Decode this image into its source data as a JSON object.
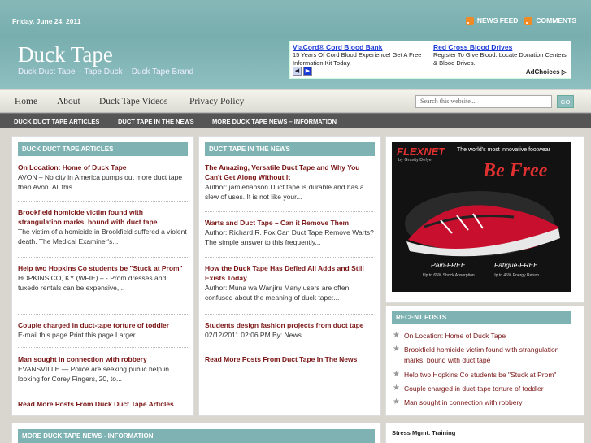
{
  "topbar": {
    "date": "Friday, June 24, 2011",
    "news_feed": "NEWS FEED",
    "comments": "COMMENTS"
  },
  "site": {
    "title": "Duck Tape",
    "tagline": "Duck Duct Tape – Tape Duck – Duck Tape Brand"
  },
  "ads": [
    {
      "title": "ViaCord® Cord Blood Bank",
      "text": "15 Years Of Cord Blood Experience! Get A Free Information Kit Today."
    },
    {
      "title": "Red Cross Blood Drives",
      "text": "Register To Give Blood. Locate Donation Centers & Blood Drives."
    }
  ],
  "adchoices": "AdChoices ▷",
  "nav": {
    "items": [
      "Home",
      "About",
      "Duck Tape Videos",
      "Privacy Policy"
    ],
    "search_placeholder": "Search this website...",
    "go": "GO"
  },
  "subnav": [
    "DUCK DUCT TAPE ARTICLES",
    "DUCT TAPE IN THE NEWS",
    "MORE DUCK TAPE NEWS – INFORMATION"
  ],
  "col1": {
    "heading": "DUCK DUCT TAPE ARTICLES",
    "posts": [
      {
        "title": "On Location: Home of Duck Tape",
        "text": "AVON – No city in America pumps out more duct tape than Avon. All this..."
      },
      {
        "title": "Brookfield homicide victim found with strangulation marks, bound with duct tape",
        "text": "The victim of a homicide in Brookfield suffered a violent death. The Medical Examiner's..."
      },
      {
        "title": "Help two Hopkins Co students be \"Stuck at Prom\"",
        "text": "HOPKINS CO, KY (WFIE) – - Prom dresses and tuxedo rentals can be expensive,..."
      },
      {
        "title": "Couple charged in duct-tape torture of toddler",
        "text": "E-mail this page Print this page Larger..."
      },
      {
        "title": "Man sought in connection with robbery",
        "text": "EVANSVILLE — Police are seeking public help in looking for Corey Fingers, 20, to..."
      }
    ],
    "more": "Read More Posts From Duck Duct Tape Articles"
  },
  "col2": {
    "heading": "DUCT TAPE IN THE NEWS",
    "posts": [
      {
        "title": "The Amazing, Versatile Duct Tape and Why You Can't Get Along Without It",
        "text": "Author: jamiehanson Duct tape is durable and has a slew of uses. It is not like your..."
      },
      {
        "title": "Warts and Duct Tape – Can it Remove Them",
        "text": "Author: Richard R. Fox Can Duct Tape Remove Warts? The simple answer to this frequently..."
      },
      {
        "title": "How the Duck Tape Has Defied All Adds and Still Exists Today",
        "text": "Author: Muna wa Wanjiru Many users are often confused about the meaning of duck tape:..."
      },
      {
        "title": "Students design fashion projects from duct tape",
        "text": "02/12/2011 02:06 PM By: News..."
      }
    ],
    "more": "Read More Posts From Duct Tape In The News"
  },
  "shoe_ad": {
    "brand": "FLEXNET",
    "brand_sub": "by Gravity Defyer",
    "headline": "The world's most innovative footwear",
    "be_free": "Be Free",
    "pain": "Pain-FREE",
    "pain_sub": "Up to 65% Shock Absorption",
    "fatigue": "Fatigue-FREE",
    "fatigue_sub": "Up to 45% Energy Return"
  },
  "recent": {
    "heading": "RECENT POSTS",
    "items": [
      "On Location: Home of Duck Tape",
      "Brookfield homicide victim found with strangulation marks, bound with duct tape",
      "Help two Hopkins Co students be \"Stuck at Prom\"",
      "Couple charged in duct-tape torture of toddler",
      "Man sought in connection with robbery"
    ]
  },
  "bottom": {
    "heading": "MORE DUCK TAPE NEWS - INFORMATION",
    "stress_title": "Stress Mgmt. Training"
  },
  "colors": {
    "teal": "#7fb3b3",
    "link": "#7a1515",
    "rss": "#f08a24"
  }
}
